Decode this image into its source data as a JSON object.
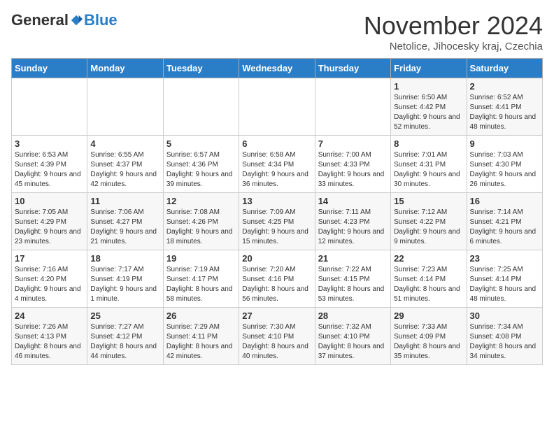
{
  "header": {
    "logo_general": "General",
    "logo_blue": "Blue",
    "title": "November 2024",
    "subtitle": "Netolice, Jihocesky kraj, Czechia"
  },
  "days_header": [
    "Sunday",
    "Monday",
    "Tuesday",
    "Wednesday",
    "Thursday",
    "Friday",
    "Saturday"
  ],
  "weeks": [
    [
      {
        "day": "",
        "info": ""
      },
      {
        "day": "",
        "info": ""
      },
      {
        "day": "",
        "info": ""
      },
      {
        "day": "",
        "info": ""
      },
      {
        "day": "",
        "info": ""
      },
      {
        "day": "1",
        "info": "Sunrise: 6:50 AM\nSunset: 4:42 PM\nDaylight: 9 hours and 52 minutes."
      },
      {
        "day": "2",
        "info": "Sunrise: 6:52 AM\nSunset: 4:41 PM\nDaylight: 9 hours and 48 minutes."
      }
    ],
    [
      {
        "day": "3",
        "info": "Sunrise: 6:53 AM\nSunset: 4:39 PM\nDaylight: 9 hours and 45 minutes."
      },
      {
        "day": "4",
        "info": "Sunrise: 6:55 AM\nSunset: 4:37 PM\nDaylight: 9 hours and 42 minutes."
      },
      {
        "day": "5",
        "info": "Sunrise: 6:57 AM\nSunset: 4:36 PM\nDaylight: 9 hours and 39 minutes."
      },
      {
        "day": "6",
        "info": "Sunrise: 6:58 AM\nSunset: 4:34 PM\nDaylight: 9 hours and 36 minutes."
      },
      {
        "day": "7",
        "info": "Sunrise: 7:00 AM\nSunset: 4:33 PM\nDaylight: 9 hours and 33 minutes."
      },
      {
        "day": "8",
        "info": "Sunrise: 7:01 AM\nSunset: 4:31 PM\nDaylight: 9 hours and 30 minutes."
      },
      {
        "day": "9",
        "info": "Sunrise: 7:03 AM\nSunset: 4:30 PM\nDaylight: 9 hours and 26 minutes."
      }
    ],
    [
      {
        "day": "10",
        "info": "Sunrise: 7:05 AM\nSunset: 4:29 PM\nDaylight: 9 hours and 23 minutes."
      },
      {
        "day": "11",
        "info": "Sunrise: 7:06 AM\nSunset: 4:27 PM\nDaylight: 9 hours and 21 minutes."
      },
      {
        "day": "12",
        "info": "Sunrise: 7:08 AM\nSunset: 4:26 PM\nDaylight: 9 hours and 18 minutes."
      },
      {
        "day": "13",
        "info": "Sunrise: 7:09 AM\nSunset: 4:25 PM\nDaylight: 9 hours and 15 minutes."
      },
      {
        "day": "14",
        "info": "Sunrise: 7:11 AM\nSunset: 4:23 PM\nDaylight: 9 hours and 12 minutes."
      },
      {
        "day": "15",
        "info": "Sunrise: 7:12 AM\nSunset: 4:22 PM\nDaylight: 9 hours and 9 minutes."
      },
      {
        "day": "16",
        "info": "Sunrise: 7:14 AM\nSunset: 4:21 PM\nDaylight: 9 hours and 6 minutes."
      }
    ],
    [
      {
        "day": "17",
        "info": "Sunrise: 7:16 AM\nSunset: 4:20 PM\nDaylight: 9 hours and 4 minutes."
      },
      {
        "day": "18",
        "info": "Sunrise: 7:17 AM\nSunset: 4:19 PM\nDaylight: 9 hours and 1 minute."
      },
      {
        "day": "19",
        "info": "Sunrise: 7:19 AM\nSunset: 4:17 PM\nDaylight: 8 hours and 58 minutes."
      },
      {
        "day": "20",
        "info": "Sunrise: 7:20 AM\nSunset: 4:16 PM\nDaylight: 8 hours and 56 minutes."
      },
      {
        "day": "21",
        "info": "Sunrise: 7:22 AM\nSunset: 4:15 PM\nDaylight: 8 hours and 53 minutes."
      },
      {
        "day": "22",
        "info": "Sunrise: 7:23 AM\nSunset: 4:14 PM\nDaylight: 8 hours and 51 minutes."
      },
      {
        "day": "23",
        "info": "Sunrise: 7:25 AM\nSunset: 4:14 PM\nDaylight: 8 hours and 48 minutes."
      }
    ],
    [
      {
        "day": "24",
        "info": "Sunrise: 7:26 AM\nSunset: 4:13 PM\nDaylight: 8 hours and 46 minutes."
      },
      {
        "day": "25",
        "info": "Sunrise: 7:27 AM\nSunset: 4:12 PM\nDaylight: 8 hours and 44 minutes."
      },
      {
        "day": "26",
        "info": "Sunrise: 7:29 AM\nSunset: 4:11 PM\nDaylight: 8 hours and 42 minutes."
      },
      {
        "day": "27",
        "info": "Sunrise: 7:30 AM\nSunset: 4:10 PM\nDaylight: 8 hours and 40 minutes."
      },
      {
        "day": "28",
        "info": "Sunrise: 7:32 AM\nSunset: 4:10 PM\nDaylight: 8 hours and 37 minutes."
      },
      {
        "day": "29",
        "info": "Sunrise: 7:33 AM\nSunset: 4:09 PM\nDaylight: 8 hours and 35 minutes."
      },
      {
        "day": "30",
        "info": "Sunrise: 7:34 AM\nSunset: 4:08 PM\nDaylight: 8 hours and 34 minutes."
      }
    ]
  ]
}
